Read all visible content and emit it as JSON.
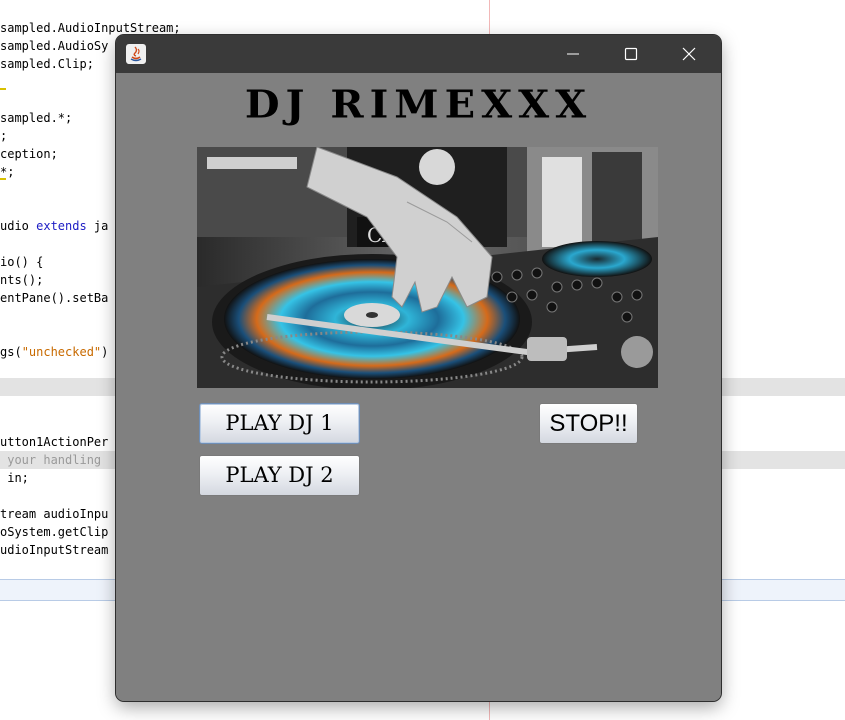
{
  "ide": {
    "lines": [
      {
        "t": "sampled.AudioInputStream;"
      },
      {
        "t": "sampled.AudioSy"
      },
      {
        "t": "sampled.Clip;"
      },
      {
        "t": ""
      },
      {
        "t": ""
      },
      {
        "t": "sampled.*;"
      },
      {
        "t": ";"
      },
      {
        "t": "ception;"
      },
      {
        "t": "*;"
      },
      {
        "t": ""
      },
      {
        "t": ""
      },
      {
        "t": "udio ",
        "kw": "extends",
        "after": " ja"
      },
      {
        "t": ""
      },
      {
        "t": "io() {"
      },
      {
        "t": "nts();"
      },
      {
        "t": "entPane().setBa"
      },
      {
        "t": ""
      },
      {
        "t": ""
      },
      {
        "t": "gs(",
        "str": "\"unchecked\"",
        "after": ")"
      },
      {
        "t": ""
      },
      {
        "t": ""
      },
      {
        "t": ""
      },
      {
        "t": ""
      },
      {
        "t": "utton1ActionPer"
      },
      {
        "t": "",
        "cm": " your handling"
      },
      {
        "t": " in;"
      },
      {
        "t": ""
      },
      {
        "t": "tream audioInpu"
      },
      {
        "t": "oSystem.getClip"
      },
      {
        "t": "udioInputStream"
      }
    ]
  },
  "window": {
    "title": "",
    "title_font_note": "",
    "app_title": "DJ RIMEXXX",
    "colors": {
      "titlebar": "#3a3a3a",
      "content_bg": "#808080"
    },
    "icons": {
      "app": "java-icon",
      "minimize": "minimize-icon",
      "maximize": "maximize-icon",
      "close": "close-icon"
    }
  },
  "buttons": {
    "play1": "PLAY DJ 1",
    "play2": "PLAY DJ 2",
    "stop": "STOP!!"
  }
}
